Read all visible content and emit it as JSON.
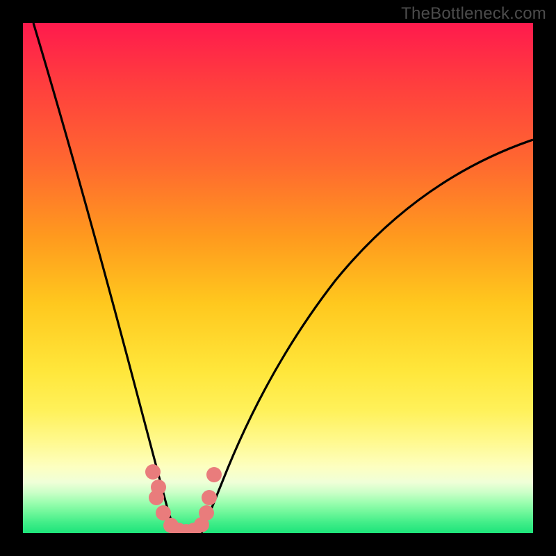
{
  "watermark": {
    "text": "TheBottleneck.com"
  },
  "colors": {
    "frame": "#000000",
    "curve_stroke": "#000000",
    "marker_fill": "#e97c7c",
    "gradient_stops": [
      "#ff1a4d",
      "#ff3e3e",
      "#ff6a2f",
      "#ff9a1e",
      "#ffc81e",
      "#ffe63a",
      "#fff15a",
      "#fff98e",
      "#fdffc0",
      "#f0ffd8",
      "#ccffc8",
      "#9cfeb0",
      "#6ef79a",
      "#40ed88",
      "#1de47a"
    ]
  },
  "chart_data": {
    "type": "line",
    "title": "",
    "xlabel": "",
    "ylabel": "",
    "xlim": [
      0,
      100
    ],
    "ylim": [
      0,
      100
    ],
    "grid": false,
    "legend": false,
    "series": [
      {
        "name": "left-curve",
        "x": [
          2,
          5,
          8,
          11,
          14,
          17,
          20,
          22,
          24,
          26,
          27,
          28,
          29,
          30
        ],
        "values": [
          100,
          89,
          77,
          65,
          53,
          41,
          30,
          22,
          15,
          9,
          5,
          2,
          0.5,
          0
        ]
      },
      {
        "name": "right-curve",
        "x": [
          35,
          36,
          38,
          40,
          43,
          47,
          52,
          58,
          65,
          73,
          82,
          91,
          100
        ],
        "values": [
          0,
          1,
          4,
          8,
          14,
          22,
          31,
          40,
          49,
          57,
          64,
          71,
          77
        ]
      },
      {
        "name": "bottom-flat",
        "x": [
          30,
          31,
          32,
          33,
          34,
          35
        ],
        "values": [
          0,
          0,
          0,
          0,
          0,
          0
        ]
      }
    ],
    "markers": {
      "name": "bottom-markers",
      "points": [
        {
          "x": 25.5,
          "y": 12
        },
        {
          "x": 26.5,
          "y": 9
        },
        {
          "x": 26.2,
          "y": 7
        },
        {
          "x": 27.5,
          "y": 4
        },
        {
          "x": 29.0,
          "y": 1.5
        },
        {
          "x": 30.5,
          "y": 0.5
        },
        {
          "x": 32.0,
          "y": 0.3
        },
        {
          "x": 33.5,
          "y": 0.5
        },
        {
          "x": 35.0,
          "y": 1.5
        },
        {
          "x": 36.0,
          "y": 4
        },
        {
          "x": 36.5,
          "y": 7
        },
        {
          "x": 37.5,
          "y": 11.5
        }
      ]
    }
  }
}
